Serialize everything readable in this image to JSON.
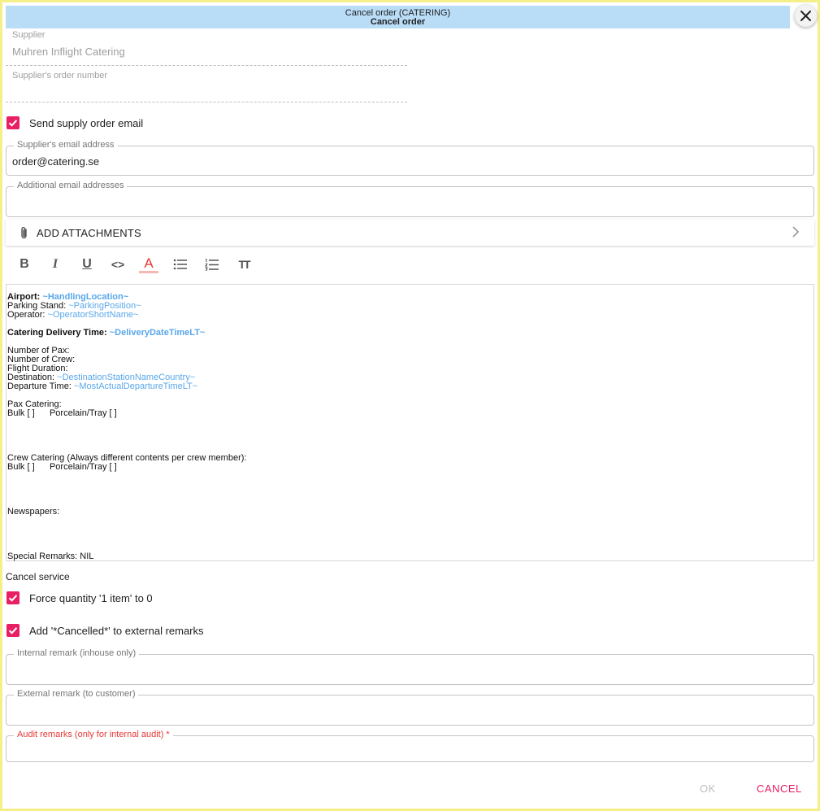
{
  "dialog": {
    "title_line1": "Cancel order (CATERING)",
    "title_line2": "Cancel order",
    "close_icon": "close-icon"
  },
  "supplier": {
    "label": "Supplier",
    "value": "Muhren Inflight Catering"
  },
  "supplier_order_number": {
    "label": "Supplier's order number",
    "value": ""
  },
  "send_email": {
    "label": "Send supply order email",
    "checked": true
  },
  "supplier_email": {
    "label": "Supplier's email address",
    "value": "order@catering.se"
  },
  "additional_emails": {
    "label": "Additional email addresses",
    "value": ""
  },
  "attachments": {
    "label": "ADD ATTACHMENTS",
    "icon": "paperclip-icon",
    "chevron": "chevron-right-icon"
  },
  "toolbar": {
    "bold": "B",
    "italic": "I",
    "underline": "U",
    "code": "<>",
    "font_color": "A",
    "font_color_accent": "#e53935",
    "bullet_list": "bullet-list-icon",
    "numbered_list": "numbered-list-icon",
    "text_size": "TT"
  },
  "editor": {
    "airport_label": "Airport:",
    "airport_value": "~HandlingLocation~",
    "parking_label": "Parking Stand:",
    "parking_value": "~ParkingPosition~",
    "operator_label": "Operator:",
    "operator_value": "~OperatorShortName~",
    "delivery_label": "Catering Delivery Time:",
    "delivery_value": "~DeliveryDateTimeLT~",
    "pax": "Number of Pax:",
    "crew": "Number of Crew:",
    "duration": "Flight Duration:",
    "destination_label": "Destination:",
    "destination_value": "~DestinationStationNameCountry~",
    "departure_label": "Departure Time:",
    "departure_value": "~MostActualDepartureTimeLT~",
    "pax_catering": "Pax Catering:",
    "pax_options": "Bulk [ ]      Porcelain/Tray [ ]",
    "crew_catering": "Crew Catering (Always different contents per crew member):",
    "crew_options": "Bulk [ ]      Porcelain/Tray [ ]",
    "newspapers": "Newspapers:",
    "special_remarks": "Special Remarks: NIL",
    "placeholder_color": "#5aa7ea"
  },
  "cancel_service": {
    "label": "Cancel service",
    "force_quantity": {
      "label": "Force quantity '1 item' to 0",
      "checked": true
    },
    "add_cancelled": {
      "label": "Add '*Cancelled*' to external remarks",
      "checked": true
    }
  },
  "internal_remark": {
    "label": "Internal remark (inhouse only)",
    "value": ""
  },
  "external_remark": {
    "label": "External remark (to customer)",
    "value": ""
  },
  "audit_remarks": {
    "label": "Audit remarks (only for internal audit) *",
    "value": "",
    "required": true
  },
  "buttons": {
    "ok": "OK",
    "cancel": "CANCEL"
  },
  "colors": {
    "accent": "#e91e63",
    "title_bg": "#b9dcf7",
    "frame": "#f5ef8a",
    "error": "#e53935"
  }
}
